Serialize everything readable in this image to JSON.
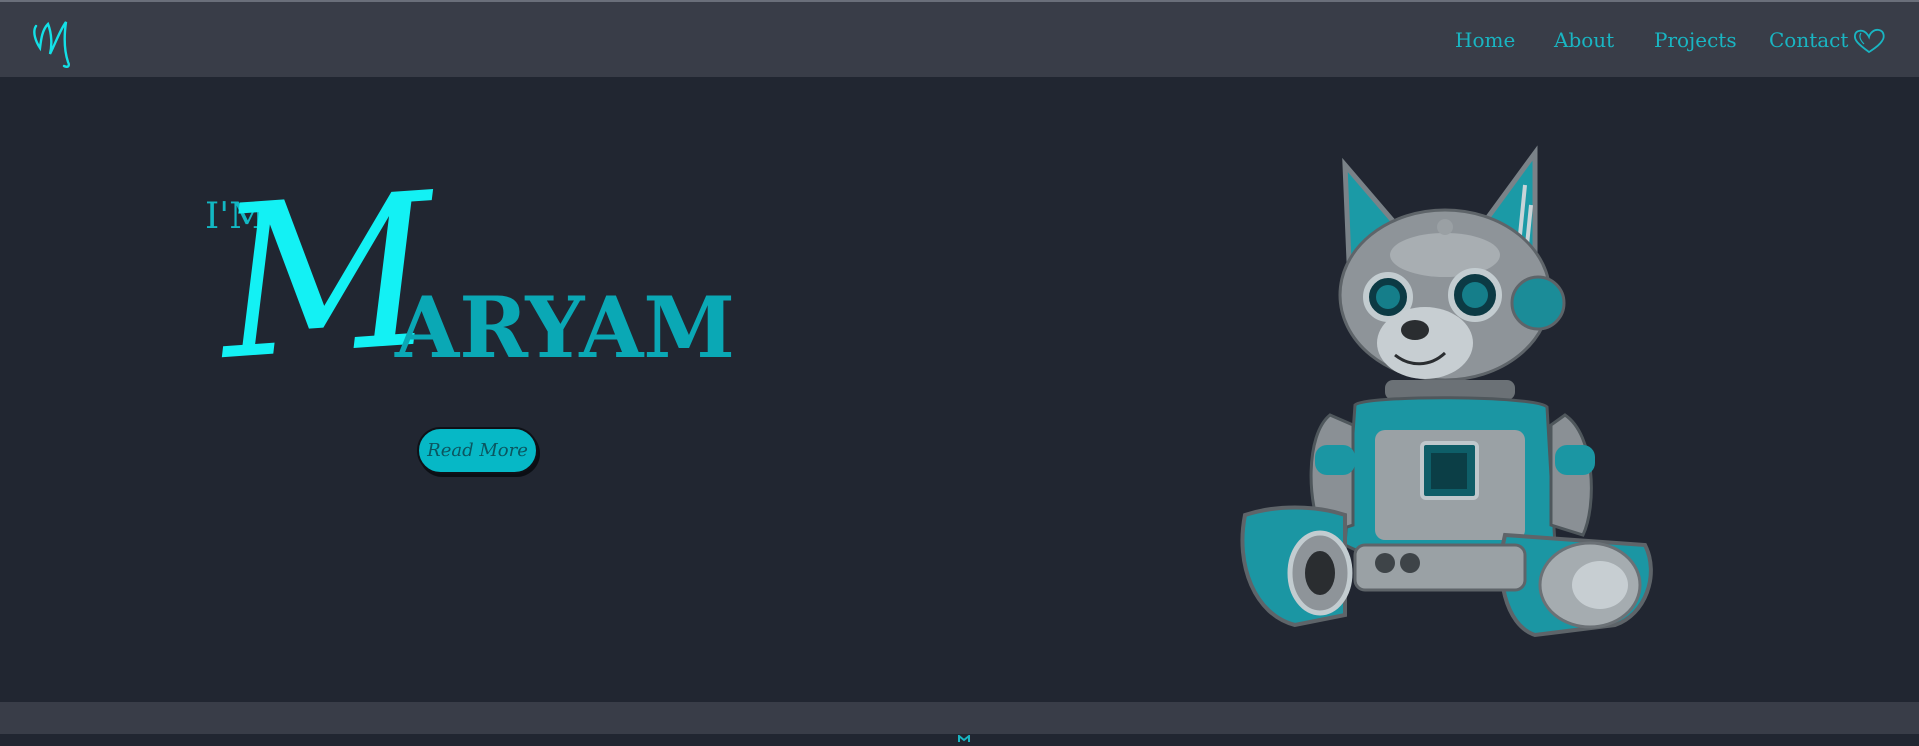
{
  "brand": {
    "logo_icon": "m-monogram-logo",
    "accent_color": "#19b5c2",
    "bright_accent": "#13f1f4"
  },
  "nav": {
    "items": [
      {
        "label": "Home"
      },
      {
        "label": "About"
      },
      {
        "label": "Projects"
      },
      {
        "label": "Contact"
      }
    ],
    "heart_icon": "heart-outline-icon"
  },
  "hero": {
    "prefix": "I'M",
    "initial": "M",
    "name_rest": "ARYAM",
    "button_label": "Read More",
    "illustration": "robot-cat-illustration"
  },
  "colors": {
    "page_bg": "#212631",
    "bar_bg": "#393d48",
    "button_bg": "#06b8c6"
  }
}
